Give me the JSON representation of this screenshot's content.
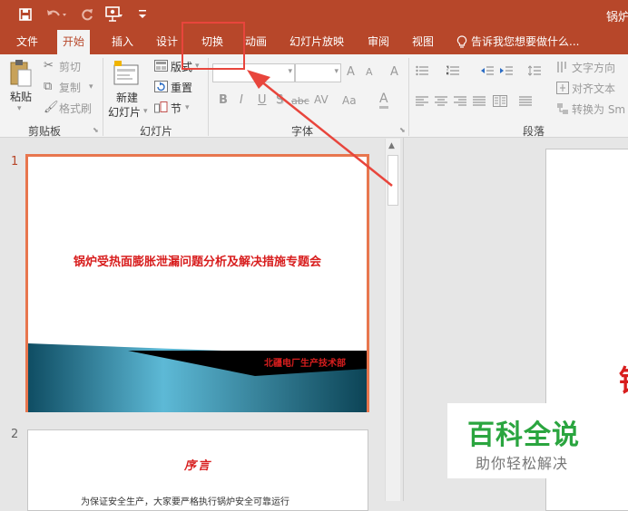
{
  "app": {
    "doc_title": "锅炉"
  },
  "quick_access": {
    "save_icon": "save-icon",
    "undo_icon": "undo-icon",
    "redo_icon": "redo-icon",
    "present_icon": "present-icon",
    "customize_icon": "customize-icon"
  },
  "tabs": [
    "文件",
    "开始",
    "插入",
    "设计",
    "切换",
    "动画",
    "幻灯片放映",
    "审阅",
    "视图"
  ],
  "tell_me": "告诉我您想要做什么...",
  "clipboard": {
    "paste": "粘贴",
    "cut": "剪切",
    "copy": "复制",
    "format_painter": "格式刷",
    "label": "剪贴板"
  },
  "slides_group": {
    "new_slide_line1": "新建",
    "new_slide_line2": "幻灯片",
    "layout": "版式",
    "reset": "重置",
    "section": "节",
    "label": "幻灯片"
  },
  "font_group": {
    "font_name": "",
    "font_size": "",
    "grow": "A",
    "shrink": "A",
    "clear": "A",
    "bold": "B",
    "italic": "I",
    "underline": "U",
    "shadow": "S",
    "strike": "abc",
    "spacing": "AV",
    "case": "Aa",
    "color": "A",
    "label": "字体"
  },
  "paragraph": {
    "text_direction": "文字方向",
    "align_text": "对齐文本",
    "convert_smartart": "转换为 Sm",
    "label": "段落"
  },
  "slides": [
    {
      "number": "1",
      "title": "锅炉受热面膨胀泄漏问题分析及解决措施专题会",
      "footer": "北疆电厂生产技术部"
    },
    {
      "number": "2",
      "title": "序言",
      "body": "为保证安全生产，大家要严格执行锅炉安全可靠运行"
    }
  ],
  "main_preview": {
    "char": "锅"
  },
  "watermark": {
    "title": "百科全说",
    "subtitle": "助你轻松解决"
  },
  "colors": {
    "accent": "#b7472a",
    "highlight": "#e8453c",
    "slide_title": "#d81e1e",
    "watermark": "#2aa53f"
  }
}
